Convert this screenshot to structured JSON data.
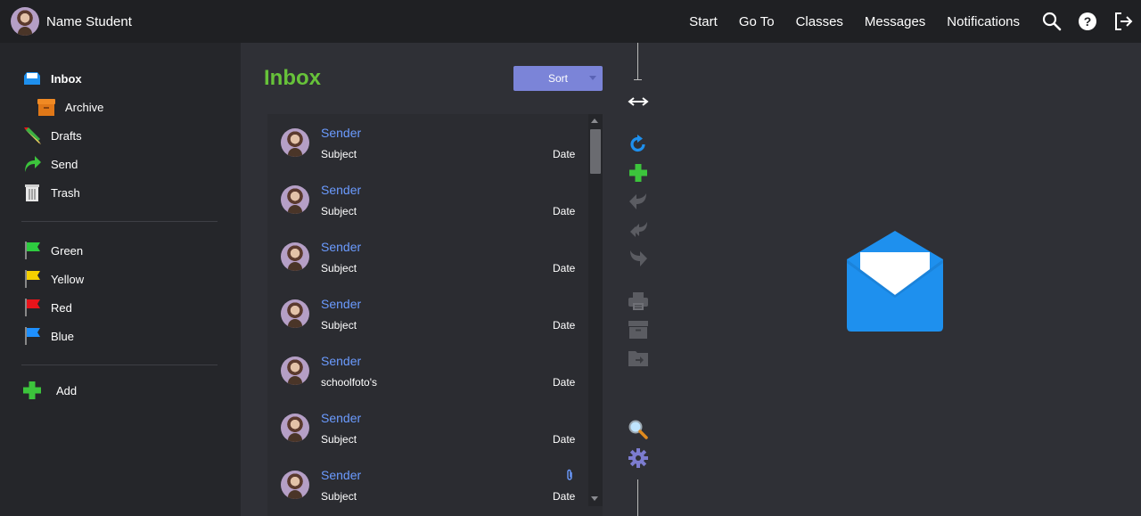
{
  "user": {
    "name": "Name Student"
  },
  "topnav": {
    "links": [
      "Start",
      "Go To",
      "Classes",
      "Messages",
      "Notifications"
    ],
    "icons": [
      "search-icon",
      "help-icon",
      "logout-icon"
    ]
  },
  "sidebar": {
    "folders": [
      {
        "label": "Inbox",
        "icon": "inbox-icon",
        "active": true
      },
      {
        "label": "Archive",
        "icon": "archive-box-icon"
      },
      {
        "label": "Drafts",
        "icon": "pencil-icon"
      },
      {
        "label": "Send",
        "icon": "send-arrow-icon"
      },
      {
        "label": "Trash",
        "icon": "trash-icon"
      }
    ],
    "flags": [
      {
        "label": "Green",
        "color": "#2ecc40"
      },
      {
        "label": "Yellow",
        "color": "#f5d000"
      },
      {
        "label": "Red",
        "color": "#e8141b"
      },
      {
        "label": "Blue",
        "color": "#1e90ff"
      }
    ],
    "add_label": "Add"
  },
  "list": {
    "title": "Inbox",
    "sort_label": "Sort",
    "messages": [
      {
        "sender": "Sender",
        "subject": "Subject",
        "date": "Date",
        "attachment": false
      },
      {
        "sender": "Sender",
        "subject": "Subject",
        "date": "Date",
        "attachment": false
      },
      {
        "sender": "Sender",
        "subject": "Subject",
        "date": "Date",
        "attachment": false
      },
      {
        "sender": "Sender",
        "subject": "Subject",
        "date": "Date",
        "attachment": false
      },
      {
        "sender": "Sender",
        "subject": "schoolfoto's",
        "date": "Date",
        "attachment": false
      },
      {
        "sender": "Sender",
        "subject": "Subject",
        "date": "Date",
        "attachment": false
      },
      {
        "sender": "Sender",
        "subject": "Subject",
        "date": "Date",
        "attachment": true
      }
    ]
  },
  "toolbar": {
    "tools": [
      "resize-horizontal-icon",
      "refresh-icon",
      "new-message-icon",
      "reply-icon",
      "reply-all-icon",
      "forward-icon",
      "print-icon",
      "archive-icon",
      "move-to-folder-icon",
      "search-zoom-icon",
      "settings-gear-icon"
    ]
  },
  "preview": {
    "icon": "open-envelope-icon"
  },
  "colors": {
    "accent_green": "#67c23a",
    "sender_blue": "#6b9bff",
    "sort_button": "#7b84d8",
    "envelope_blue": "#1e90ee"
  }
}
